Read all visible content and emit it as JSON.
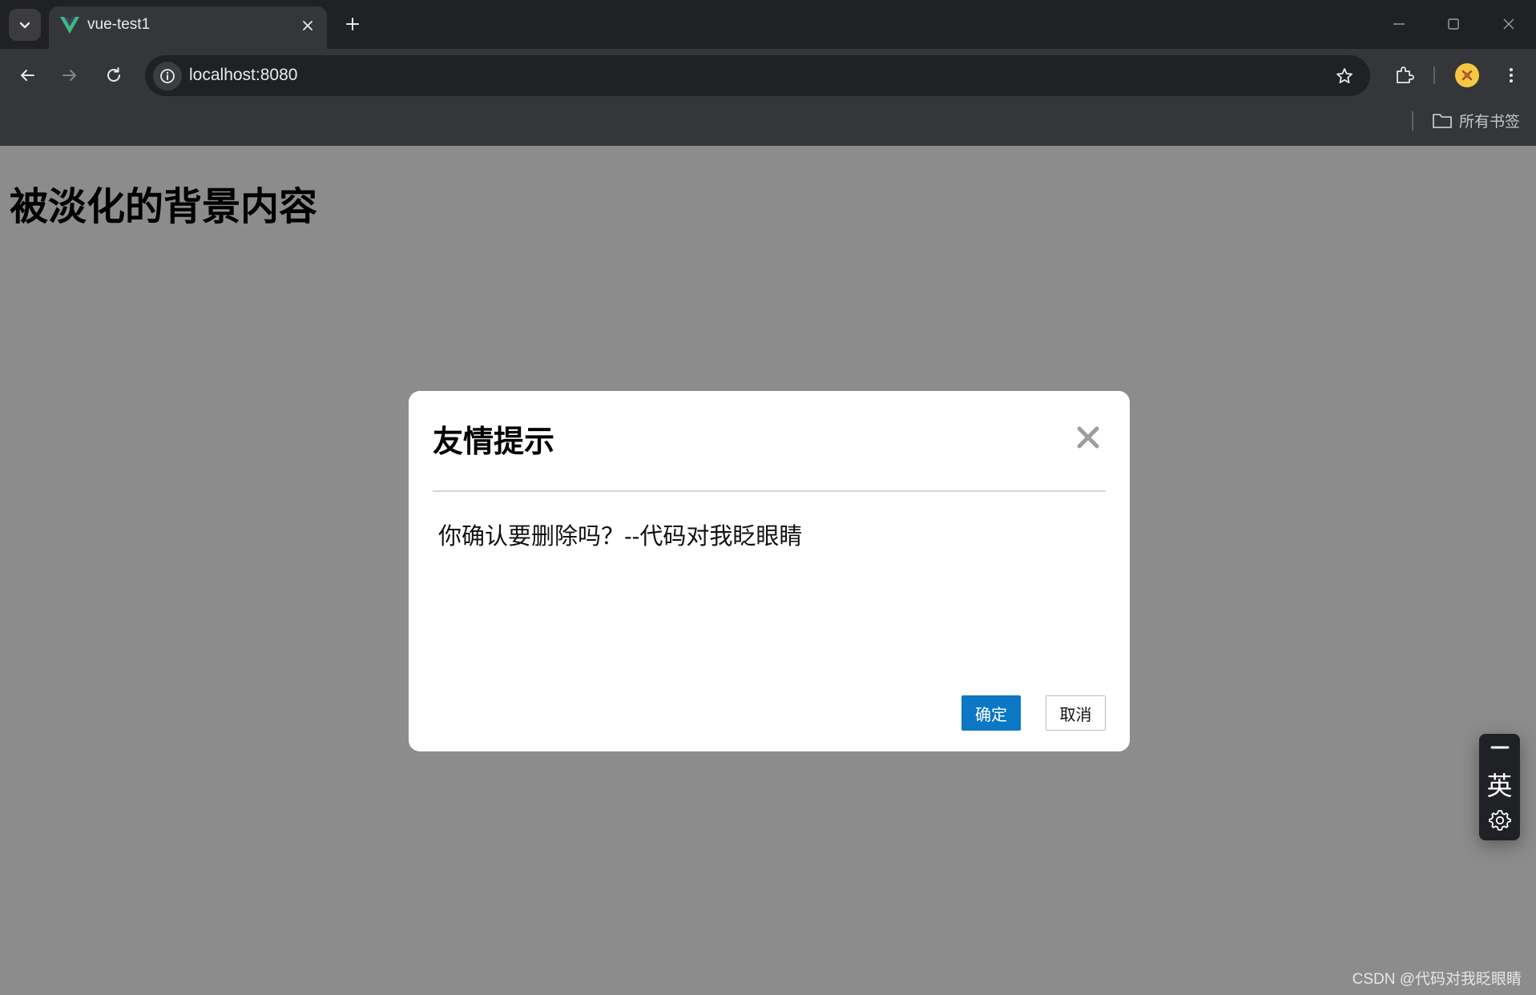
{
  "browser": {
    "tab": {
      "title": "vue-test1"
    },
    "address_bar": {
      "url": "localhost:8080"
    },
    "bookmarks_bar": {
      "folder_label": "所有书签"
    }
  },
  "page": {
    "background_heading": "被淡化的背景内容"
  },
  "dialog": {
    "title": "友情提示",
    "message": "你确认要删除吗？--代码对我眨眼睛",
    "confirm_label": "确定",
    "cancel_label": "取消"
  },
  "ime": {
    "mode_label": "英"
  },
  "watermark": "CSDN @代码对我眨眼睛",
  "colors": {
    "tabstrip": "#202124",
    "toolbar": "#35363a",
    "overlay_dim": "rgba(0,0,0,0.45)",
    "confirm_button": "#0c77c5",
    "vue_logo_green": "#41b883",
    "vue_logo_dark": "#35495e"
  },
  "icons": [
    "tab-search-icon",
    "vue-logo-icon",
    "close-icon",
    "plus-icon",
    "minimize-icon",
    "maximize-icon",
    "window-close-icon",
    "back-arrow-icon",
    "forward-arrow-icon",
    "reload-icon",
    "site-info-icon",
    "star-icon",
    "extensions-icon",
    "profile-avatar-icon",
    "more-vert-icon",
    "folder-icon",
    "dialog-close-icon",
    "ime-minimize-icon",
    "gear-icon"
  ]
}
